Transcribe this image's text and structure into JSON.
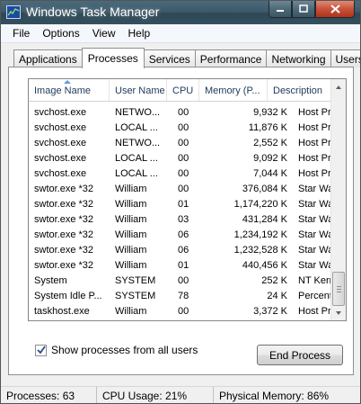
{
  "window": {
    "title": "Windows Task Manager",
    "icon": "task-manager-icon",
    "caption_buttons": [
      "minimize-icon",
      "maximize-icon",
      "close-icon"
    ]
  },
  "menu": [
    "File",
    "Options",
    "View",
    "Help"
  ],
  "tabs": [
    {
      "label": "Applications",
      "active": false
    },
    {
      "label": "Processes",
      "active": true
    },
    {
      "label": "Services",
      "active": false
    },
    {
      "label": "Performance",
      "active": false
    },
    {
      "label": "Networking",
      "active": false
    },
    {
      "label": "Users",
      "active": false
    }
  ],
  "table": {
    "columns": [
      "Image Name",
      "User Name",
      "CPU",
      "Memory (P...",
      "Description"
    ],
    "sorted_column": "Image Name",
    "rows": [
      [
        "svchost.exe",
        "NETWO...",
        "00",
        "9,932 K",
        "Host Proc..."
      ],
      [
        "svchost.exe",
        "LOCAL ...",
        "00",
        "11,876 K",
        "Host Proc..."
      ],
      [
        "svchost.exe",
        "NETWO...",
        "00",
        "2,552 K",
        "Host Proc..."
      ],
      [
        "svchost.exe",
        "LOCAL ...",
        "00",
        "9,092 K",
        "Host Proc..."
      ],
      [
        "svchost.exe",
        "LOCAL ...",
        "00",
        "7,044 K",
        "Host Proc..."
      ],
      [
        "swtor.exe *32",
        "William",
        "00",
        "376,084 K",
        "Star Wars..."
      ],
      [
        "swtor.exe *32",
        "William",
        "01",
        "1,174,220 K",
        "Star Wars..."
      ],
      [
        "swtor.exe *32",
        "William",
        "03",
        "431,284 K",
        "Star Wars..."
      ],
      [
        "swtor.exe *32",
        "William",
        "06",
        "1,234,192 K",
        "Star Wars..."
      ],
      [
        "swtor.exe *32",
        "William",
        "06",
        "1,232,528 K",
        "Star Wars..."
      ],
      [
        "swtor.exe *32",
        "William",
        "01",
        "440,456 K",
        "Star Wars..."
      ],
      [
        "System",
        "SYSTEM",
        "00",
        "252 K",
        "NT Kernel..."
      ],
      [
        "System Idle P...",
        "SYSTEM",
        "78",
        "24 K",
        "Percenta..."
      ],
      [
        "taskhost.exe",
        "William",
        "00",
        "3,372 K",
        "Host Proc..."
      ]
    ]
  },
  "show_all_processes": {
    "label": "Show processes from all users",
    "checked": true
  },
  "end_process_button": "End Process",
  "status": {
    "processes": "Processes: 63",
    "cpu": "CPU Usage: 21%",
    "memory": "Physical Memory: 86%"
  }
}
